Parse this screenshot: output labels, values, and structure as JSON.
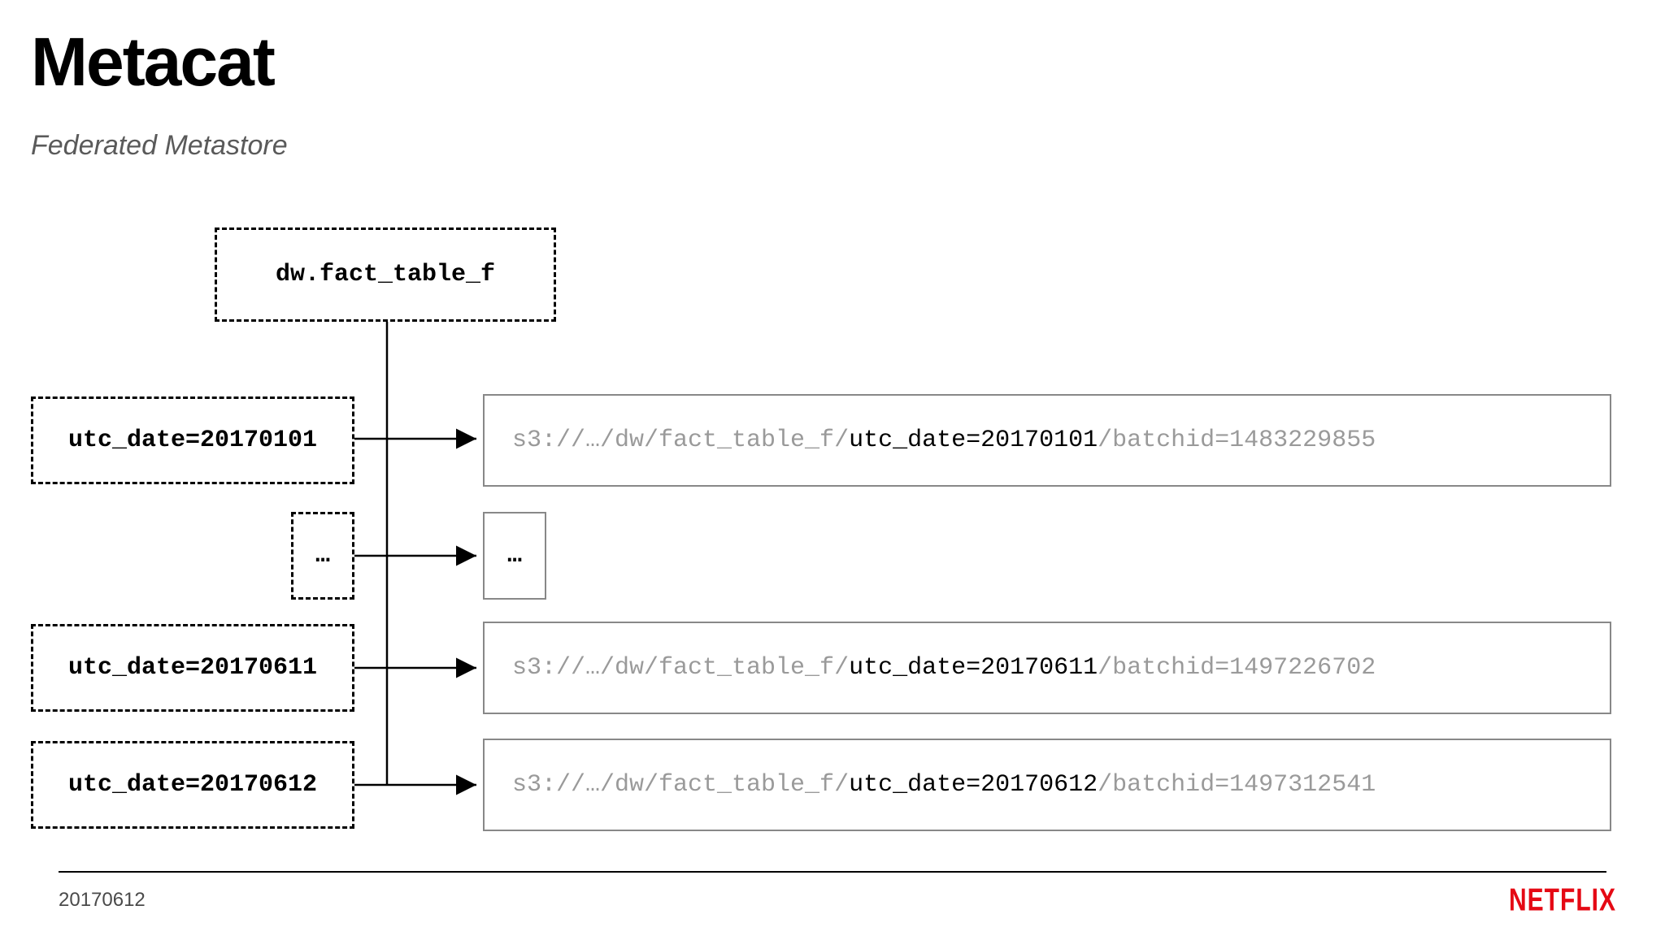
{
  "title": "Metacat",
  "subtitle": "Federated Metastore",
  "table_name": "dw.fact_table_f",
  "partitions": [
    {
      "label": "utc_date=20170101",
      "prefix": "s3://…/dw/fact_table_f/",
      "mid": "utc_date=20170101",
      "suffix": "/batchid=1483229855"
    },
    {
      "label": "…",
      "ellipsis": true
    },
    {
      "label": "utc_date=20170611",
      "prefix": "s3://…/dw/fact_table_f/",
      "mid": "utc_date=20170611",
      "suffix": "/batchid=1497226702"
    },
    {
      "label": "utc_date=20170612",
      "prefix": "s3://…/dw/fact_table_f/",
      "mid": "utc_date=20170612",
      "suffix": "/batchid=1497312541"
    }
  ],
  "ellipsis_display": "…",
  "footer_date": "20170612",
  "brand": "NETFLIX"
}
